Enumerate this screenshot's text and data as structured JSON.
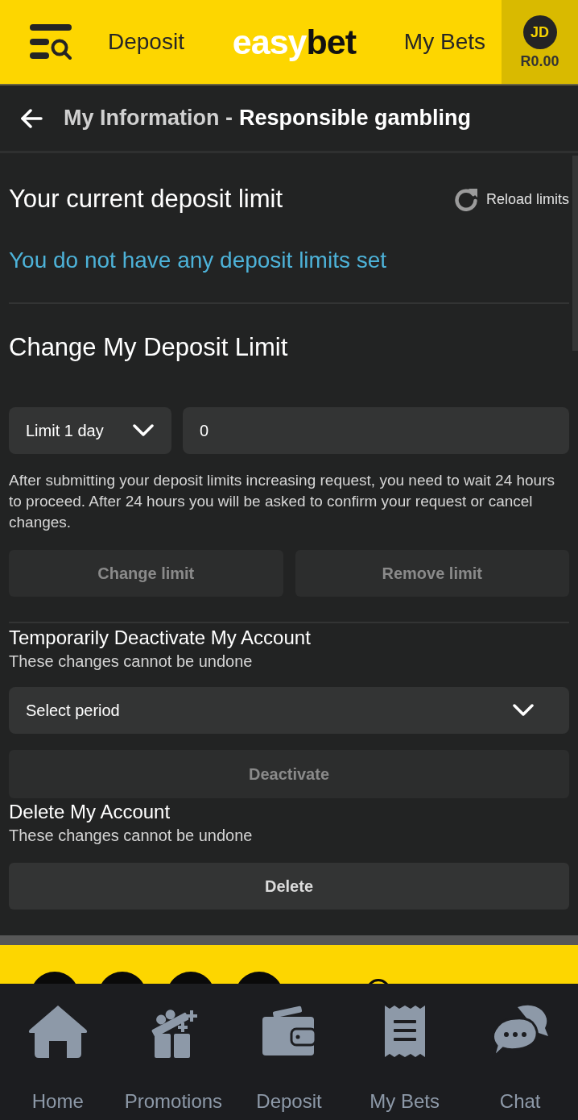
{
  "header": {
    "left_link": "Deposit",
    "logo": {
      "first": "easy",
      "second": "bet"
    },
    "right_link": "My Bets",
    "account": {
      "initials": "JD",
      "balance": "R0.00"
    }
  },
  "page_header": {
    "parent": "My Information -",
    "title": "Responsible gambling"
  },
  "current_limit": {
    "title": "Your current deposit limit",
    "reload": "Reload limits",
    "message": "You do not have any deposit limits set"
  },
  "change_limit": {
    "title": "Change My Deposit Limit",
    "period_select": {
      "value": "Limit 1 day"
    },
    "amount_field": {
      "value": "0"
    },
    "note": "After submitting your deposit limits increasing request, you need to wait 24 hours to proceed. After 24 hours you will be asked to confirm your request or cancel changes.",
    "buttons": [
      {
        "label": "Change limit",
        "disabled": true
      },
      {
        "label": "Remove limit",
        "disabled": true
      }
    ]
  },
  "deactivate": {
    "title": "Temporarily Deactivate My Account",
    "subtitle": "These changes cannot be undone",
    "period_select": {
      "label": "Select period"
    },
    "button": {
      "label": "Deactivate",
      "disabled": true
    }
  },
  "delete": {
    "title": "Delete My Account",
    "subtitle": "These changes cannot be undone",
    "button": {
      "label": "Delete",
      "disabled": false
    }
  },
  "bottom_nav": [
    {
      "kind": "home",
      "label": "Home"
    },
    {
      "kind": "promotions",
      "label": "Promotions"
    },
    {
      "kind": "deposit",
      "label": "Deposit"
    },
    {
      "kind": "bets",
      "label": "My Bets"
    },
    {
      "kind": "chat",
      "label": "Chat"
    }
  ]
}
